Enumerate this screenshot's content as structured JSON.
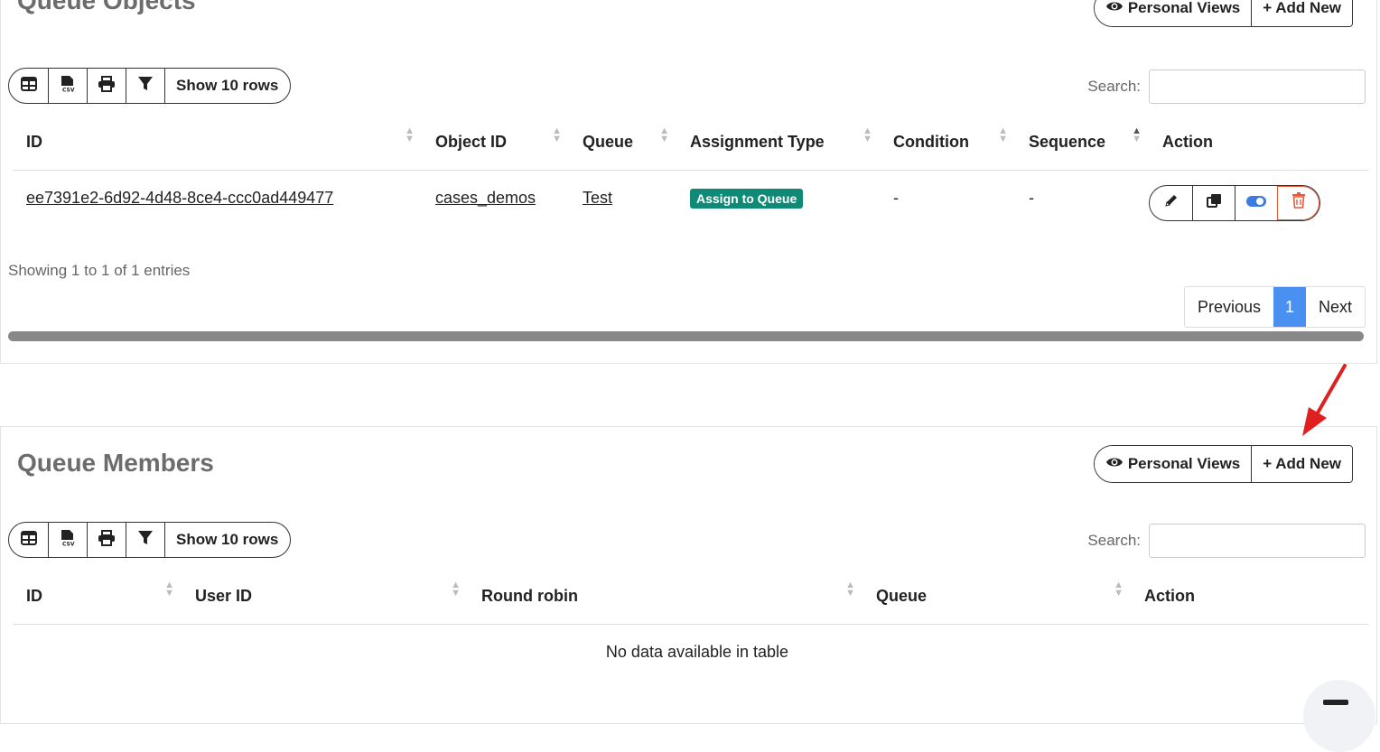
{
  "queue_objects": {
    "title": "Queue Objects",
    "personal_views": "Personal Views",
    "add_new": "+ Add New",
    "show_rows": "Show 10 rows",
    "search_label": "Search:",
    "columns": [
      "ID",
      "Object ID",
      "Queue",
      "Assignment Type",
      "Condition",
      "Sequence",
      "Action"
    ],
    "rows": [
      {
        "id": "ee7391e2-6d92-4d48-8ce4-ccc0ad449477",
        "object_id": "cases_demos",
        "queue": "Test",
        "assignment_type": "Assign to Queue",
        "condition": "-",
        "sequence": "-"
      }
    ],
    "info": "Showing 1 to 1 of 1 entries",
    "pagination": {
      "previous": "Previous",
      "current": "1",
      "next": "Next"
    }
  },
  "queue_members": {
    "title": "Queue Members",
    "personal_views": "Personal Views",
    "add_new": "+ Add New",
    "show_rows": "Show 10 rows",
    "search_label": "Search:",
    "columns": [
      "ID",
      "User ID",
      "Round robin",
      "Queue",
      "Action"
    ],
    "empty": "No data available in table"
  },
  "colors": {
    "badge": "#0f8a76",
    "active_page": "#4a90f0",
    "delete": "#e45b3c",
    "arrow": "#e02020"
  }
}
